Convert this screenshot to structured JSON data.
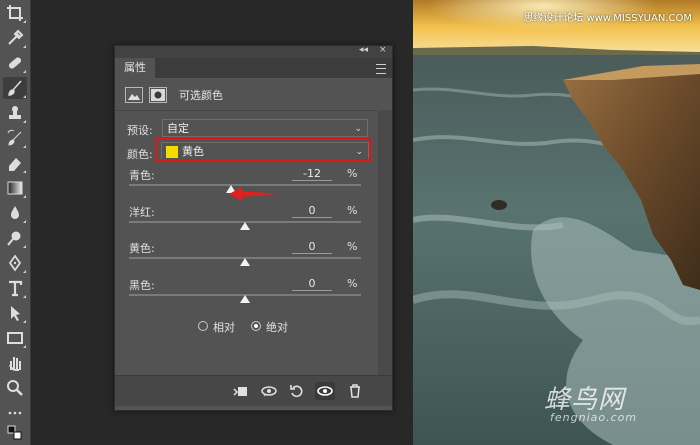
{
  "toolbar": {
    "tools": [
      "crop-icon",
      "eyedropper-icon",
      "healing-brush-icon",
      "brush-icon",
      "clone-stamp-icon",
      "history-brush-icon",
      "eraser-icon",
      "gradient-icon",
      "blur-icon",
      "dodge-icon",
      "pen-icon",
      "type-icon",
      "path-selection-icon",
      "rectangle-icon",
      "hand-icon",
      "zoom-icon",
      "more-icon"
    ],
    "active_index": 3
  },
  "panel": {
    "tab_label": "属性",
    "collapse_glyph": "◂◂",
    "close_glyph": "×",
    "adjustment_title": "可选颜色",
    "preset_label": "预设:",
    "preset_value": "自定",
    "color_label": "颜色:",
    "color_value": "黄色",
    "color_swatch": "#f5dc00",
    "sliders": [
      {
        "label": "青色:",
        "value": "-12",
        "unit": "%",
        "level": -12
      },
      {
        "label": "洋红:",
        "value": "0",
        "unit": "%",
        "level": 0
      },
      {
        "label": "黄色:",
        "value": "0",
        "unit": "%",
        "level": 0
      },
      {
        "label": "黑色:",
        "value": "0",
        "unit": "%",
        "level": 0
      }
    ],
    "method": {
      "relative_label": "相对",
      "absolute_label": "绝对",
      "selected": "absolute"
    },
    "bottom_icons": [
      "clip-to-layer-icon",
      "view-previous-icon",
      "reset-icon",
      "visibility-icon",
      "delete-icon"
    ]
  },
  "highlight_color": "#e01515",
  "watermark": {
    "top": "思缘设计论坛  www.MISSYUAN.COM",
    "brand_cn": "蜂鸟网",
    "brand_en": "fengniao.com"
  }
}
